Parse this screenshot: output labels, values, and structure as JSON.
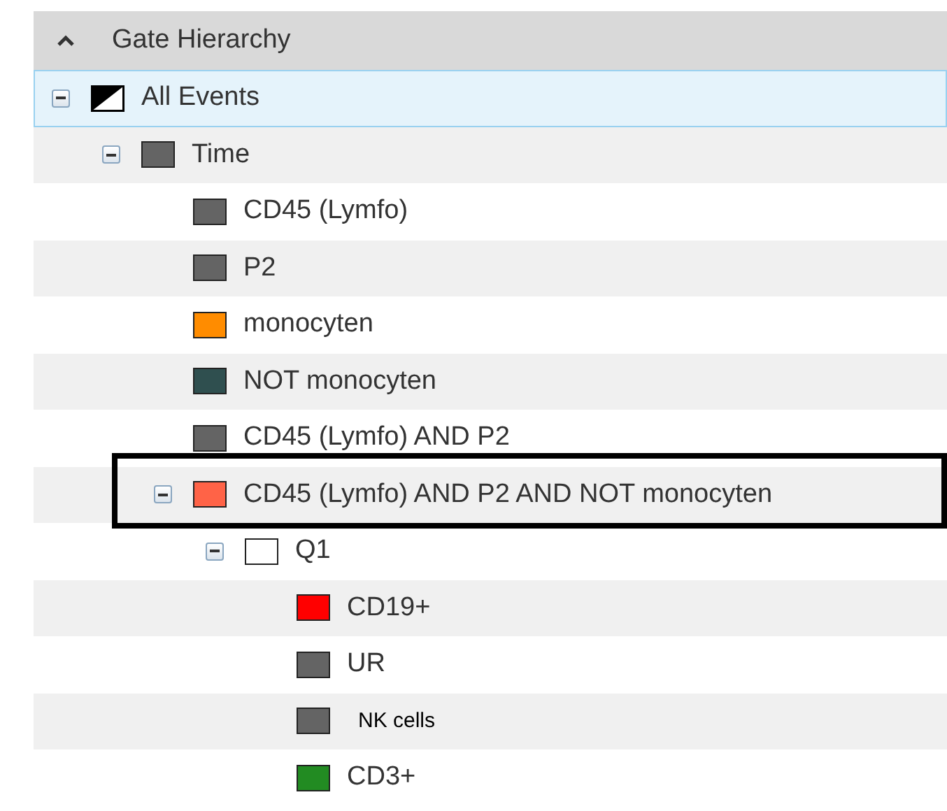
{
  "panel": {
    "title": "Gate Hierarchy",
    "expanded": true
  },
  "tree": [
    {
      "label": "All Events",
      "kind": "split",
      "selected": true,
      "expanded": true,
      "children": [
        {
          "label": "Time",
          "color": "#646464",
          "selected": false,
          "expanded": true,
          "children": [
            {
              "label": "CD45 (Lymfo)",
              "color": "#646464",
              "selected": false
            },
            {
              "label": "P2",
              "color": "#646464",
              "selected": false
            },
            {
              "label": "monocyten",
              "color": "#ff8c00",
              "selected": false
            },
            {
              "label": "NOT monocyten",
              "color": "#2f4f4f",
              "selected": false
            },
            {
              "label": "CD45 (Lymfo) AND P2",
              "color": "#646464",
              "selected": false
            },
            {
              "label": "CD45 (Lymfo) AND P2 AND NOT monocyten",
              "color": "#ff6347",
              "selected": false,
              "expanded": true,
              "highlighted": true,
              "children": [
                {
                  "label": "Q1",
                  "color": "#ffffff",
                  "selected": false,
                  "expanded": true,
                  "children": [
                    {
                      "label": "CD19+",
                      "color": "#ff0000",
                      "selected": false
                    },
                    {
                      "label": "UR",
                      "color": "#646464",
                      "selected": false
                    },
                    {
                      "label": "NK cells",
                      "color": "#646464",
                      "selected": false,
                      "relabeled": true
                    },
                    {
                      "label": "CD3+",
                      "color": "#228b22",
                      "selected": false
                    }
                  ]
                }
              ]
            }
          ]
        }
      ]
    }
  ]
}
